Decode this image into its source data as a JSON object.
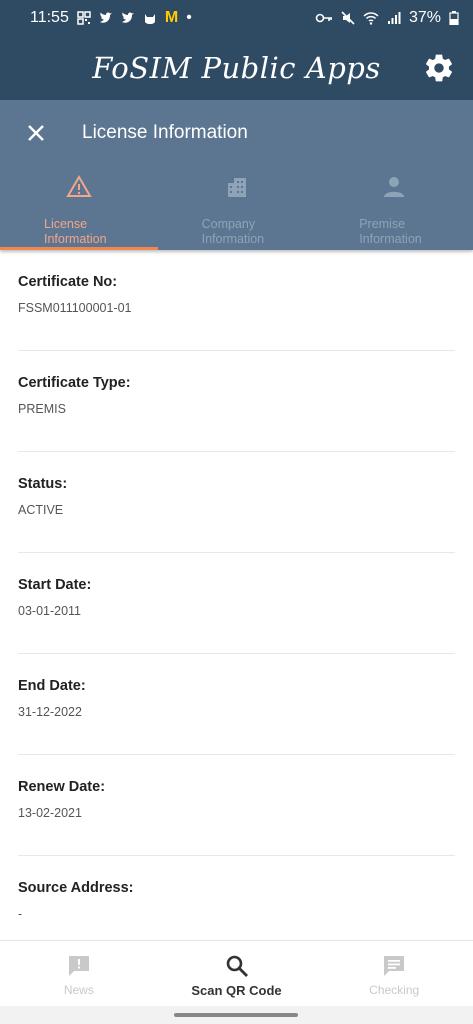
{
  "status_bar": {
    "time": "11:55",
    "battery": "37%",
    "icons": [
      "qr-icon",
      "twitter-icon",
      "twitter-icon",
      "cat-icon",
      "mcdonalds-icon",
      "dot-icon",
      "key-icon",
      "mute-icon",
      "wifi-icon",
      "signal-icon",
      "battery-icon"
    ],
    "mcd_glyph": "M",
    "dot": "•"
  },
  "app_bar": {
    "title": "FoSIM Public Apps",
    "settings_icon": "gear-icon"
  },
  "license_header": {
    "title": "License Information",
    "close_icon": "close-icon",
    "tabs": [
      {
        "label": "License Information",
        "icon": "warning-triangle-icon",
        "active": true
      },
      {
        "label": "Company Information",
        "icon": "building-icon",
        "active": false
      },
      {
        "label": "Premise Information",
        "icon": "person-icon",
        "active": false
      }
    ]
  },
  "fields": [
    {
      "label": "Certificate No:",
      "value": "FSSM011100001-01"
    },
    {
      "label": "Certificate Type:",
      "value": "PREMIS"
    },
    {
      "label": "Status:",
      "value": "ACTIVE"
    },
    {
      "label": "Start Date:",
      "value": "03-01-2011"
    },
    {
      "label": "End Date:",
      "value": "31-12-2022"
    },
    {
      "label": "Renew Date:",
      "value": "13-02-2021"
    },
    {
      "label": "Source Address:",
      "value": "-"
    }
  ],
  "bottom_nav": {
    "items": [
      {
        "label": "News",
        "icon": "news-icon",
        "active": false
      },
      {
        "label": "Scan QR Code",
        "icon": "search-icon",
        "active": true
      },
      {
        "label": "Checking",
        "icon": "chat-icon",
        "active": false
      }
    ]
  },
  "colors": {
    "header": "#2f4a63",
    "license_header": "#5c7590",
    "active_tab": "#f2a68c",
    "indicator": "#f0874f"
  }
}
